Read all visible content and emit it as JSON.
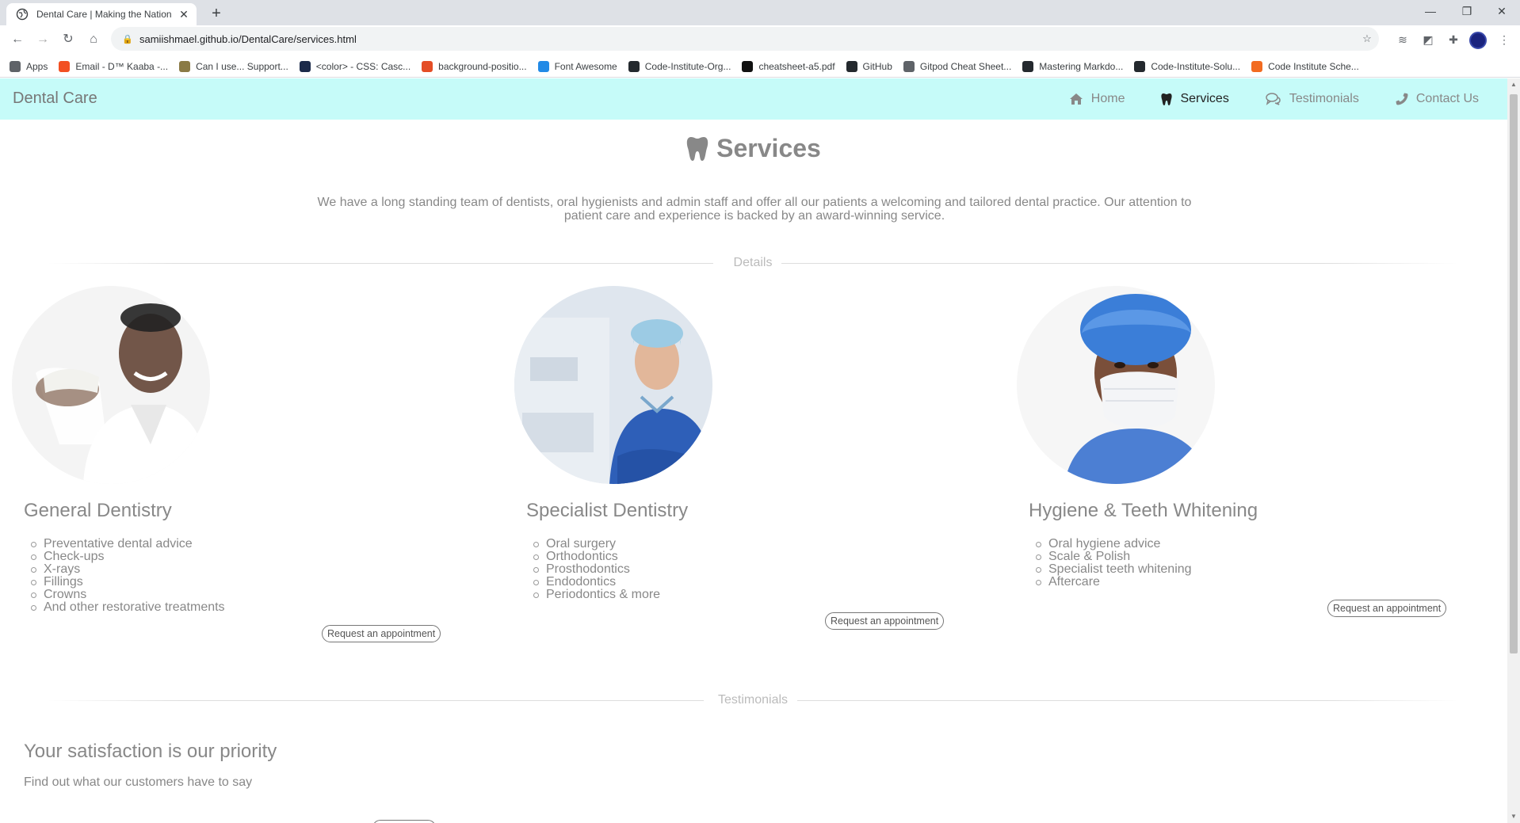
{
  "browser": {
    "tab_title": "Dental Care | Making the Nation",
    "url": "samiishmael.github.io/DentalCare/services.html",
    "bookmarks": [
      {
        "label": "Apps",
        "icon": "apps-grid-icon",
        "color": "#5f6368"
      },
      {
        "label": "Email - D™ Kaaba -...",
        "icon": "microsoft-icon",
        "color": "#f25022"
      },
      {
        "label": "Can I use... Support...",
        "icon": "caniuse-icon",
        "color": "#8a7a45"
      },
      {
        "label": "<color> - CSS: Casc...",
        "icon": "mdn-icon",
        "color": "#1b2a4a"
      },
      {
        "label": "background-positio...",
        "icon": "codepen-icon",
        "color": "#e44d26"
      },
      {
        "label": "Font Awesome",
        "icon": "fontawesome-flag-icon",
        "color": "#228ae6"
      },
      {
        "label": "Code-Institute-Org...",
        "icon": "github-icon",
        "color": "#24292e"
      },
      {
        "label": "cheatsheet-a5.pdf",
        "icon": "pdf-globe-icon",
        "color": "#111"
      },
      {
        "label": "GitHub",
        "icon": "github-icon",
        "color": "#24292e"
      },
      {
        "label": "Gitpod Cheat Sheet...",
        "icon": "globe-icon",
        "color": "#5f6368"
      },
      {
        "label": "Mastering Markdo...",
        "icon": "github-icon",
        "color": "#24292e"
      },
      {
        "label": "Code-Institute-Solu...",
        "icon": "github-icon",
        "color": "#24292e"
      },
      {
        "label": "Code Institute Sche...",
        "icon": "code-institute-icon",
        "color": "#f26b21"
      }
    ]
  },
  "navbar": {
    "brand": "Dental Care",
    "links": [
      {
        "label": "Home",
        "icon": "home-icon",
        "active": false
      },
      {
        "label": "Services",
        "icon": "tooth-icon",
        "active": true
      },
      {
        "label": "Testimonials",
        "icon": "comments-icon",
        "active": false
      },
      {
        "label": "Contact Us",
        "icon": "phone-icon",
        "active": false
      }
    ],
    "bg_color": "#c6fbf9"
  },
  "services": {
    "title": "Services",
    "intro": "We have a long standing team of dentists, oral hygienists and admin staff and offer all our patients a welcoming and tailored dental practice. Our attention to patient care and experience is backed by an award-winning service.",
    "divider_label": "Details",
    "cards": [
      {
        "heading": "General Dentistry",
        "items": [
          "Preventative dental advice",
          "Check-ups",
          "X-rays",
          "Fillings",
          "Crowns",
          "And other restorative treatments"
        ],
        "button": "Request an appointment"
      },
      {
        "heading": "Specialist Dentistry",
        "items": [
          "Oral surgery",
          "Orthodontics",
          "Prosthodontics",
          "Endodontics",
          "Periodontics & more"
        ],
        "button": "Request an appointment"
      },
      {
        "heading": "Hygiene & Teeth Whitening",
        "items": [
          "Oral hygiene advice",
          "Scale & Polish",
          "Specialist teeth whitening",
          "Aftercare"
        ],
        "button": "Request an appointment"
      }
    ]
  },
  "testimonials": {
    "divider_label": "Testimonials",
    "heading": "Your satisfaction is our priority",
    "subheading": "Find out what our customers have to say"
  }
}
